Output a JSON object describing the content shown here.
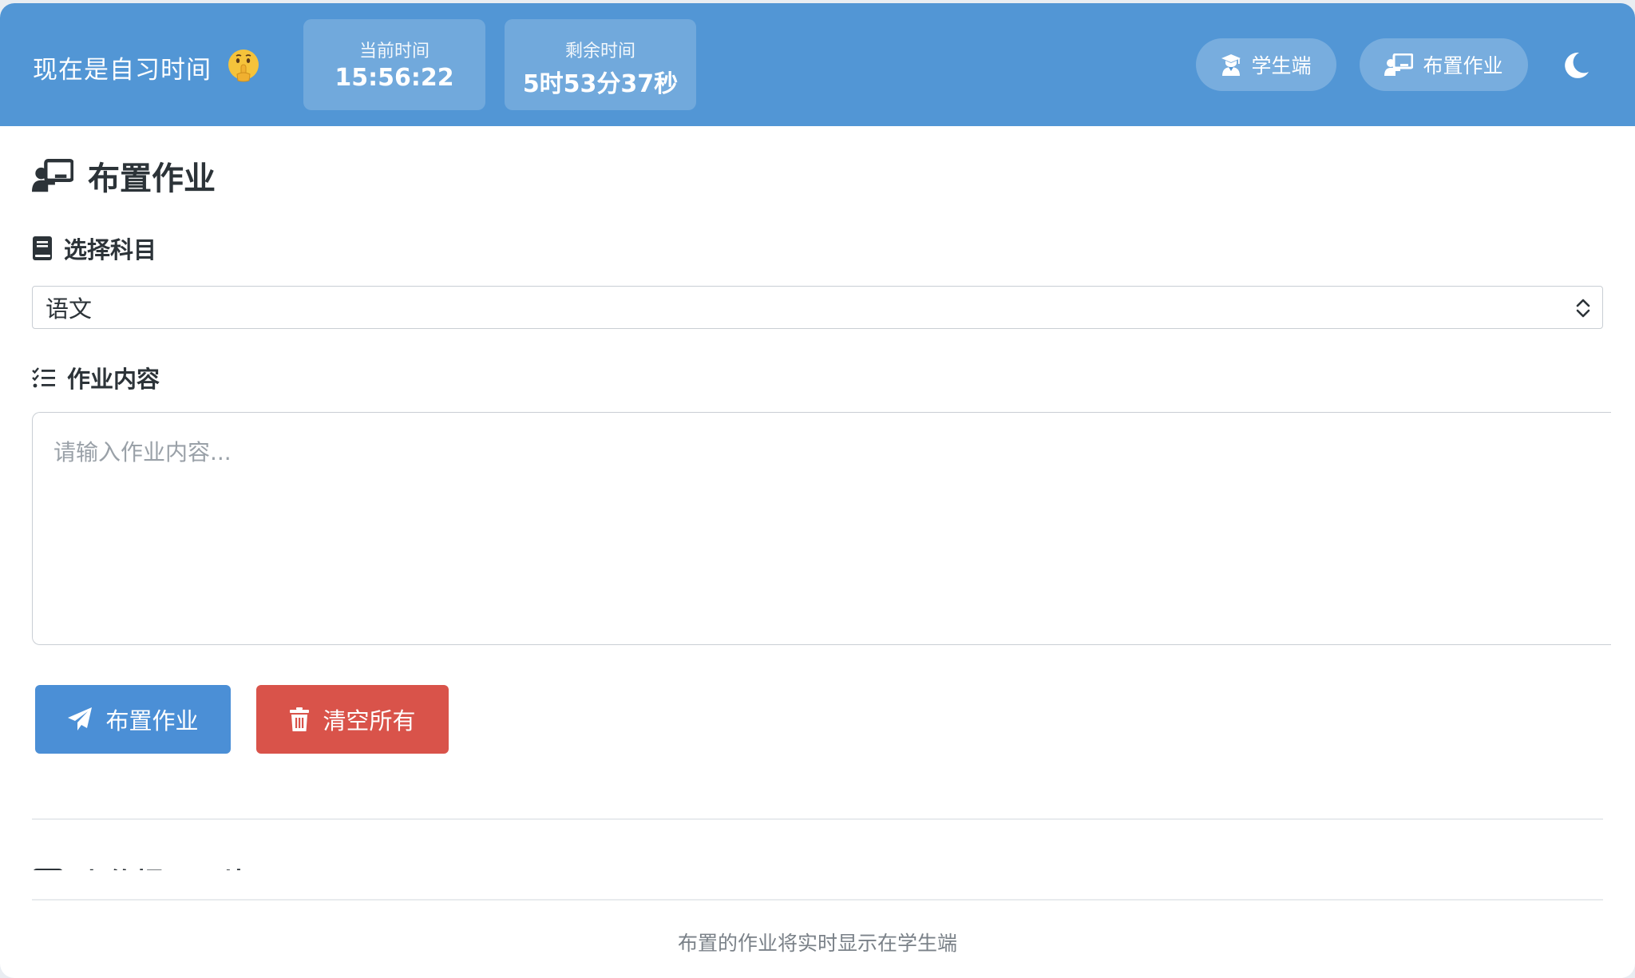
{
  "header": {
    "status_text": "现在是自习时间",
    "status_emoji_icon": "shushing-face-emoji",
    "current_time": {
      "label": "当前时间",
      "value": "15:56:22"
    },
    "remaining_time": {
      "label": "剩余时间",
      "value": "5时53分37秒"
    },
    "nav": {
      "student_label": "学生端",
      "assign_label": "布置作业"
    },
    "theme_toggle_icon": "moon-icon"
  },
  "main": {
    "title": "布置作业",
    "subject_label": "选择科目",
    "subject_selected": "语文",
    "content_label": "作业内容",
    "content_placeholder": "请输入作业内容...",
    "assign_button_label": "布置作业",
    "clear_button_label": "清空所有",
    "next_section_title": "上传提示图片",
    "footer_note": "布置的作业将实时显示在学生端"
  },
  "colors": {
    "header_bg": "#5296d5",
    "primary": "#4b8fd6",
    "danger": "#d9534a"
  }
}
